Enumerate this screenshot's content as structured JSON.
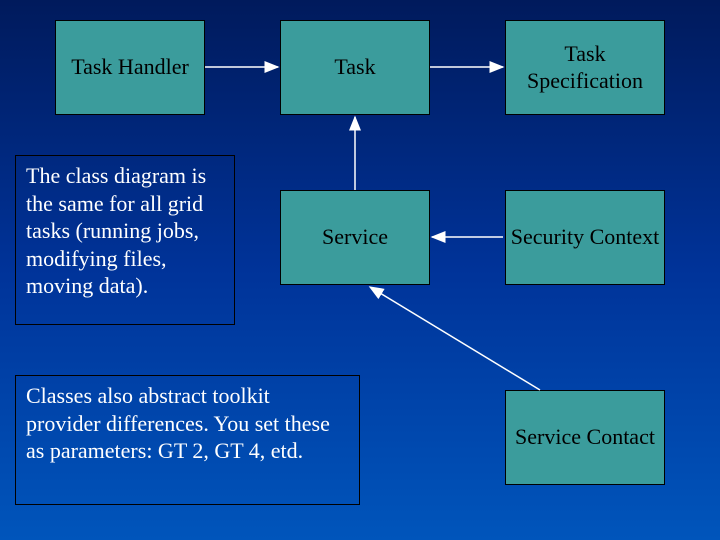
{
  "boxes": {
    "task_handler": "Task\nHandler",
    "task": "Task",
    "task_specification": "Task\nSpecification",
    "service": "Service",
    "security_context": "Security\nContext",
    "service_contact": "Service\nContact"
  },
  "notes": {
    "class_diagram": "The class diagram is the\nsame for all grid tasks (running jobs, modifying files, moving data).",
    "toolkit": "Classes also abstract toolkit provider differences.  You set these as parameters: GT 2, GT 4, etd."
  }
}
